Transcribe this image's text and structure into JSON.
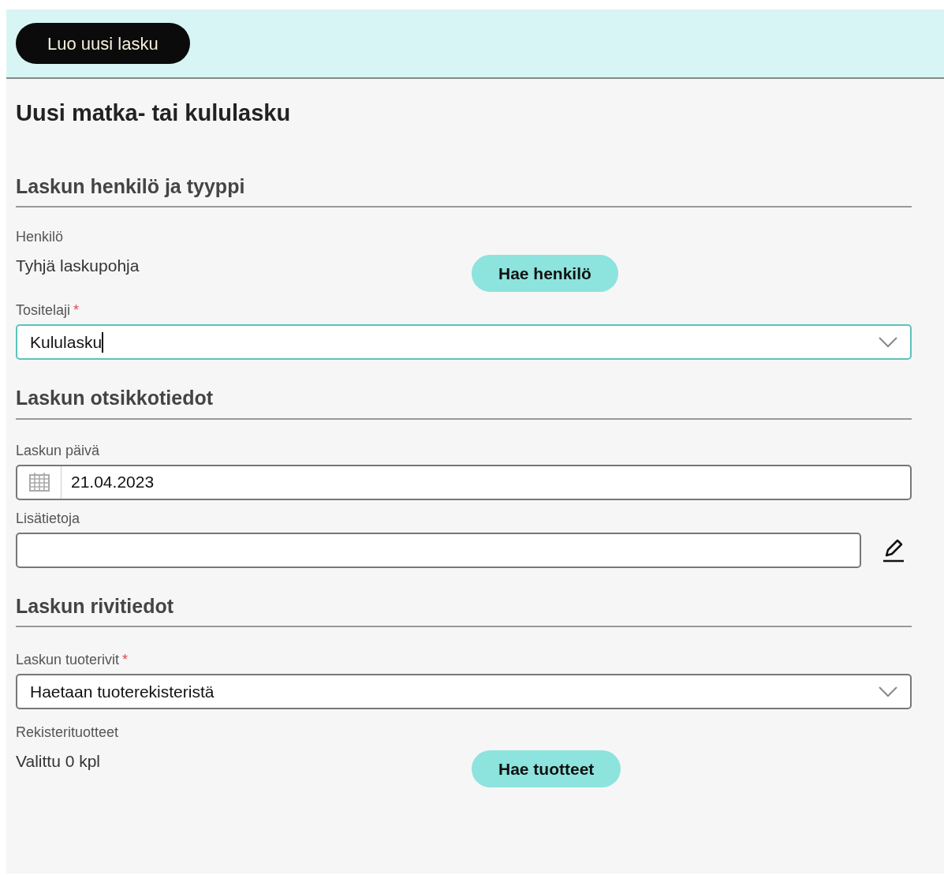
{
  "toolbar": {
    "button": "Luo uusi lasku"
  },
  "title": "Uusi matka- tai kululasku",
  "sections": [
    {
      "heading": "Laskun henkilö ja tyyppi",
      "fields": [
        {
          "kind": "picker",
          "label": "Henkilö",
          "value": "Tyhjä laskupohja",
          "button": "Hae henkilö"
        },
        {
          "kind": "select",
          "label": "Tositelaji",
          "required_mark": "*",
          "value": "Kululasku",
          "focused": true
        }
      ]
    },
    {
      "heading": "Laskun otsikkotiedot",
      "fields": [
        {
          "kind": "date",
          "label": "Laskun päivä",
          "value": "21.04.2023"
        },
        {
          "kind": "text",
          "label": "Lisätietoja"
        }
      ]
    },
    {
      "heading": "Laskun rivitiedot",
      "fields": [
        {
          "kind": "select",
          "label": "Laskun tuoterivit",
          "required_mark": "*",
          "value": "Haetaan tuoterekisteristä",
          "focused": false
        },
        {
          "kind": "picker",
          "label": "Rekisterituotteet",
          "value": "Valittu 0 kpl",
          "button": "Hae tuotteet"
        }
      ]
    }
  ]
}
